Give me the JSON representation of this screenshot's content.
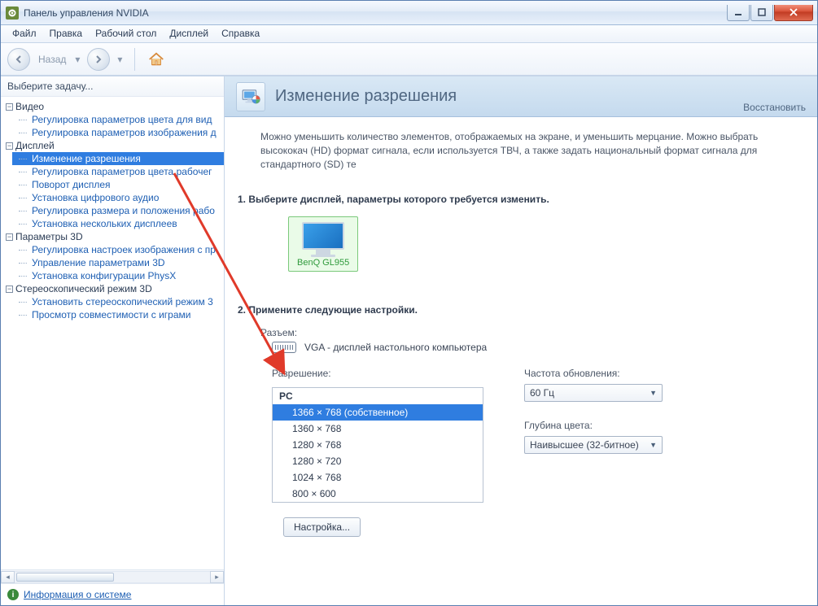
{
  "window": {
    "title": "Панель управления NVIDIA"
  },
  "menu": {
    "file": "Файл",
    "edit": "Правка",
    "desktop": "Рабочий стол",
    "display": "Дисплей",
    "help": "Справка"
  },
  "nav": {
    "back": "Назад"
  },
  "sidebar": {
    "header": "Выберите задачу...",
    "groups": [
      {
        "label": "Видео",
        "items": [
          "Регулировка параметров цвета для вид",
          "Регулировка параметров изображения д"
        ]
      },
      {
        "label": "Дисплей",
        "items": [
          "Изменение разрешения",
          "Регулировка параметров цвета рабочег",
          "Поворот дисплея",
          "Установка цифрового аудио",
          "Регулировка размера и положения рабо",
          "Установка нескольких дисплеев"
        ],
        "selected_index": 0
      },
      {
        "label": "Параметры 3D",
        "items": [
          "Регулировка настроек изображения с пр",
          "Управление параметрами 3D",
          "Установка конфигурации PhysX"
        ]
      },
      {
        "label": "Стереоскопический режим 3D",
        "items": [
          "Установить стереоскопический режим 3",
          "Просмотр совместимости с играми"
        ]
      }
    ],
    "sysinfo": "Информация о системе"
  },
  "page": {
    "title": "Изменение разрешения",
    "restore": "Восстановить",
    "intro": "Можно уменьшить количество элементов, отображаемых на экране, и уменьшить мерцание. Можно выбрать высококач (HD) формат сигнала, если используется ТВЧ, а также задать национальный формат сигнала для стандартного (SD) те",
    "step1": "1. Выберите дисплей, параметры которого требуется изменить.",
    "display_name": "BenQ GL955",
    "step2": "2. Примените следующие настройки.",
    "connector_label": "Разъем:",
    "connector_value": "VGA - дисплей настольного компьютера",
    "resolution_label": "Разрешение:",
    "res_group_pc": "PC",
    "resolutions": [
      "1366 × 768 (собственное)",
      "1360 × 768",
      "1280 × 768",
      "1280 × 720",
      "1024 × 768",
      "800 × 600"
    ],
    "res_selected_index": 0,
    "refresh_label": "Частота обновления:",
    "refresh_value": "60 Гц",
    "depth_label": "Глубина цвета:",
    "depth_value": "Наивысшее (32-битное)",
    "customize": "Настройка..."
  }
}
